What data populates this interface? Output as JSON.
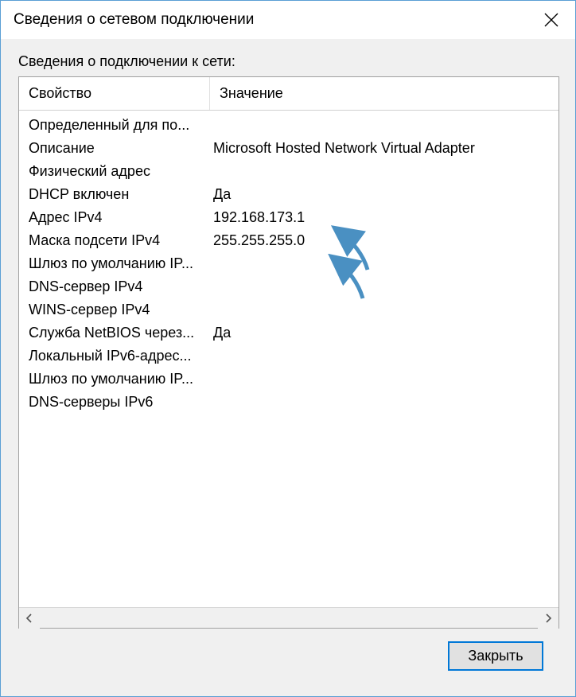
{
  "window": {
    "title": "Сведения о сетевом подключении",
    "close_button_label": "Закрыть"
  },
  "section_label": "Сведения о подключении к сети:",
  "columns": {
    "property": "Свойство",
    "value": "Значение"
  },
  "rows": [
    {
      "property": "Определенный для по...",
      "value": ""
    },
    {
      "property": "Описание",
      "value": "Microsoft Hosted Network Virtual Adapter"
    },
    {
      "property": "Физический адрес",
      "value": ""
    },
    {
      "property": "DHCP включен",
      "value": "Да"
    },
    {
      "property": "Адрес IPv4",
      "value": "192.168.173.1"
    },
    {
      "property": "Маска подсети IPv4",
      "value": "255.255.255.0"
    },
    {
      "property": "Шлюз по умолчанию IP...",
      "value": ""
    },
    {
      "property": "DNS-сервер IPv4",
      "value": ""
    },
    {
      "property": "WINS-сервер IPv4",
      "value": ""
    },
    {
      "property": "Служба NetBIOS через...",
      "value": "Да"
    },
    {
      "property": "Локальный IPv6-адрес...",
      "value": ""
    },
    {
      "property": "Шлюз по умолчанию IP...",
      "value": ""
    },
    {
      "property": "DNS-серверы IPv6",
      "value": ""
    }
  ],
  "annotation_color": "#4a90c2"
}
